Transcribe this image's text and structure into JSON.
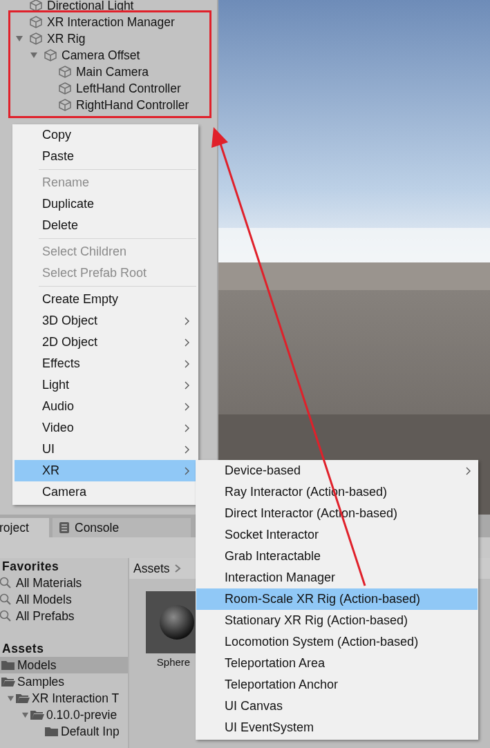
{
  "hierarchy": {
    "items": [
      {
        "label": "Directional Light"
      },
      {
        "label": "XR Interaction Manager"
      },
      {
        "label": "XR Rig",
        "expanded": true,
        "children": [
          {
            "label": "Camera Offset",
            "expanded": true,
            "children": [
              {
                "label": "Main Camera"
              },
              {
                "label": "LeftHand Controller"
              },
              {
                "label": "RightHand Controller"
              }
            ]
          }
        ]
      }
    ]
  },
  "context_menu": {
    "groups": [
      [
        {
          "label": "Copy",
          "disabled": false,
          "submenu": false,
          "selected": false
        },
        {
          "label": "Paste",
          "disabled": false,
          "submenu": false,
          "selected": false
        }
      ],
      [
        {
          "label": "Rename",
          "disabled": true,
          "submenu": false,
          "selected": false
        },
        {
          "label": "Duplicate",
          "disabled": false,
          "submenu": false,
          "selected": false
        },
        {
          "label": "Delete",
          "disabled": false,
          "submenu": false,
          "selected": false
        }
      ],
      [
        {
          "label": "Select Children",
          "disabled": true,
          "submenu": false,
          "selected": false
        },
        {
          "label": "Select Prefab Root",
          "disabled": true,
          "submenu": false,
          "selected": false
        }
      ],
      [
        {
          "label": "Create Empty",
          "disabled": false,
          "submenu": false,
          "selected": false
        },
        {
          "label": "3D Object",
          "disabled": false,
          "submenu": true,
          "selected": false
        },
        {
          "label": "2D Object",
          "disabled": false,
          "submenu": true,
          "selected": false
        },
        {
          "label": "Effects",
          "disabled": false,
          "submenu": true,
          "selected": false
        },
        {
          "label": "Light",
          "disabled": false,
          "submenu": true,
          "selected": false
        },
        {
          "label": "Audio",
          "disabled": false,
          "submenu": true,
          "selected": false
        },
        {
          "label": "Video",
          "disabled": false,
          "submenu": true,
          "selected": false
        },
        {
          "label": "UI",
          "disabled": false,
          "submenu": true,
          "selected": false
        },
        {
          "label": "XR",
          "disabled": false,
          "submenu": true,
          "selected": true
        },
        {
          "label": "Camera",
          "disabled": false,
          "submenu": false,
          "selected": false
        }
      ]
    ]
  },
  "xr_submenu": {
    "items": [
      {
        "label": "Device-based",
        "submenu": true,
        "selected": false
      },
      {
        "label": "Ray Interactor (Action-based)",
        "submenu": false,
        "selected": false
      },
      {
        "label": "Direct Interactor (Action-based)",
        "submenu": false,
        "selected": false
      },
      {
        "label": "Socket Interactor",
        "submenu": false,
        "selected": false
      },
      {
        "label": "Grab Interactable",
        "submenu": false,
        "selected": false
      },
      {
        "label": "Interaction Manager",
        "submenu": false,
        "selected": false
      },
      {
        "label": "Room-Scale XR Rig (Action-based)",
        "submenu": false,
        "selected": true
      },
      {
        "label": "Stationary XR Rig (Action-based)",
        "submenu": false,
        "selected": false
      },
      {
        "label": "Locomotion System (Action-based)",
        "submenu": false,
        "selected": false
      },
      {
        "label": "Teleportation Area",
        "submenu": false,
        "selected": false
      },
      {
        "label": "Teleportation Anchor",
        "submenu": false,
        "selected": false
      },
      {
        "label": "UI Canvas",
        "submenu": false,
        "selected": false
      },
      {
        "label": "UI EventSystem",
        "submenu": false,
        "selected": false
      }
    ]
  },
  "project_panel": {
    "tabs": [
      {
        "label": "roject",
        "kind": "project",
        "selected": true
      },
      {
        "label": "Console",
        "kind": "console",
        "selected": false
      }
    ],
    "favorites": {
      "title": "Favorites",
      "items": [
        "All Materials",
        "All Models",
        "All Prefabs"
      ]
    },
    "assets": {
      "title": "Assets",
      "items": [
        {
          "label": "Models",
          "selected": true
        },
        {
          "label": "Samples",
          "selected": false,
          "expanded": true,
          "children": [
            {
              "label": "XR Interaction T",
              "selected": false,
              "expanded": true,
              "children": [
                {
                  "label": "0.10.0-previe",
                  "selected": false,
                  "expanded": true,
                  "children": [
                    {
                      "label": "Default Inp",
                      "selected": false
                    }
                  ]
                }
              ]
            }
          ]
        }
      ]
    },
    "breadcrumb": [
      "Assets"
    ],
    "grid": [
      {
        "name": "Sphere"
      }
    ]
  }
}
